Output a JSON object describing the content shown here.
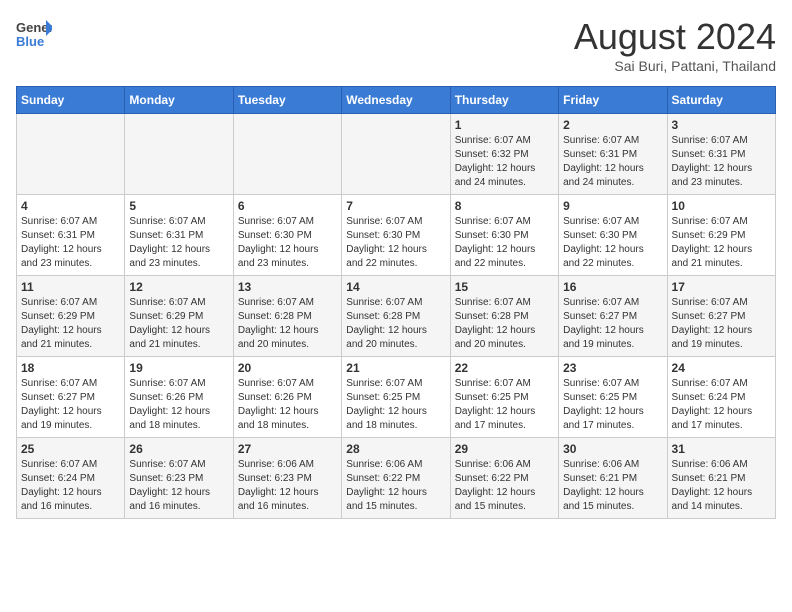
{
  "header": {
    "logo_general": "General",
    "logo_blue": "Blue",
    "month_year": "August 2024",
    "location": "Sai Buri, Pattani, Thailand"
  },
  "weekdays": [
    "Sunday",
    "Monday",
    "Tuesday",
    "Wednesday",
    "Thursday",
    "Friday",
    "Saturday"
  ],
  "rows": [
    [
      {
        "day": "",
        "info": ""
      },
      {
        "day": "",
        "info": ""
      },
      {
        "day": "",
        "info": ""
      },
      {
        "day": "",
        "info": ""
      },
      {
        "day": "1",
        "info": "Sunrise: 6:07 AM\nSunset: 6:32 PM\nDaylight: 12 hours\nand 24 minutes."
      },
      {
        "day": "2",
        "info": "Sunrise: 6:07 AM\nSunset: 6:31 PM\nDaylight: 12 hours\nand 24 minutes."
      },
      {
        "day": "3",
        "info": "Sunrise: 6:07 AM\nSunset: 6:31 PM\nDaylight: 12 hours\nand 23 minutes."
      }
    ],
    [
      {
        "day": "4",
        "info": "Sunrise: 6:07 AM\nSunset: 6:31 PM\nDaylight: 12 hours\nand 23 minutes."
      },
      {
        "day": "5",
        "info": "Sunrise: 6:07 AM\nSunset: 6:31 PM\nDaylight: 12 hours\nand 23 minutes."
      },
      {
        "day": "6",
        "info": "Sunrise: 6:07 AM\nSunset: 6:30 PM\nDaylight: 12 hours\nand 23 minutes."
      },
      {
        "day": "7",
        "info": "Sunrise: 6:07 AM\nSunset: 6:30 PM\nDaylight: 12 hours\nand 22 minutes."
      },
      {
        "day": "8",
        "info": "Sunrise: 6:07 AM\nSunset: 6:30 PM\nDaylight: 12 hours\nand 22 minutes."
      },
      {
        "day": "9",
        "info": "Sunrise: 6:07 AM\nSunset: 6:30 PM\nDaylight: 12 hours\nand 22 minutes."
      },
      {
        "day": "10",
        "info": "Sunrise: 6:07 AM\nSunset: 6:29 PM\nDaylight: 12 hours\nand 21 minutes."
      }
    ],
    [
      {
        "day": "11",
        "info": "Sunrise: 6:07 AM\nSunset: 6:29 PM\nDaylight: 12 hours\nand 21 minutes."
      },
      {
        "day": "12",
        "info": "Sunrise: 6:07 AM\nSunset: 6:29 PM\nDaylight: 12 hours\nand 21 minutes."
      },
      {
        "day": "13",
        "info": "Sunrise: 6:07 AM\nSunset: 6:28 PM\nDaylight: 12 hours\nand 20 minutes."
      },
      {
        "day": "14",
        "info": "Sunrise: 6:07 AM\nSunset: 6:28 PM\nDaylight: 12 hours\nand 20 minutes."
      },
      {
        "day": "15",
        "info": "Sunrise: 6:07 AM\nSunset: 6:28 PM\nDaylight: 12 hours\nand 20 minutes."
      },
      {
        "day": "16",
        "info": "Sunrise: 6:07 AM\nSunset: 6:27 PM\nDaylight: 12 hours\nand 19 minutes."
      },
      {
        "day": "17",
        "info": "Sunrise: 6:07 AM\nSunset: 6:27 PM\nDaylight: 12 hours\nand 19 minutes."
      }
    ],
    [
      {
        "day": "18",
        "info": "Sunrise: 6:07 AM\nSunset: 6:27 PM\nDaylight: 12 hours\nand 19 minutes."
      },
      {
        "day": "19",
        "info": "Sunrise: 6:07 AM\nSunset: 6:26 PM\nDaylight: 12 hours\nand 18 minutes."
      },
      {
        "day": "20",
        "info": "Sunrise: 6:07 AM\nSunset: 6:26 PM\nDaylight: 12 hours\nand 18 minutes."
      },
      {
        "day": "21",
        "info": "Sunrise: 6:07 AM\nSunset: 6:25 PM\nDaylight: 12 hours\nand 18 minutes."
      },
      {
        "day": "22",
        "info": "Sunrise: 6:07 AM\nSunset: 6:25 PM\nDaylight: 12 hours\nand 17 minutes."
      },
      {
        "day": "23",
        "info": "Sunrise: 6:07 AM\nSunset: 6:25 PM\nDaylight: 12 hours\nand 17 minutes."
      },
      {
        "day": "24",
        "info": "Sunrise: 6:07 AM\nSunset: 6:24 PM\nDaylight: 12 hours\nand 17 minutes."
      }
    ],
    [
      {
        "day": "25",
        "info": "Sunrise: 6:07 AM\nSunset: 6:24 PM\nDaylight: 12 hours\nand 16 minutes."
      },
      {
        "day": "26",
        "info": "Sunrise: 6:07 AM\nSunset: 6:23 PM\nDaylight: 12 hours\nand 16 minutes."
      },
      {
        "day": "27",
        "info": "Sunrise: 6:06 AM\nSunset: 6:23 PM\nDaylight: 12 hours\nand 16 minutes."
      },
      {
        "day": "28",
        "info": "Sunrise: 6:06 AM\nSunset: 6:22 PM\nDaylight: 12 hours\nand 15 minutes."
      },
      {
        "day": "29",
        "info": "Sunrise: 6:06 AM\nSunset: 6:22 PM\nDaylight: 12 hours\nand 15 minutes."
      },
      {
        "day": "30",
        "info": "Sunrise: 6:06 AM\nSunset: 6:21 PM\nDaylight: 12 hours\nand 15 minutes."
      },
      {
        "day": "31",
        "info": "Sunrise: 6:06 AM\nSunset: 6:21 PM\nDaylight: 12 hours\nand 14 minutes."
      }
    ]
  ]
}
